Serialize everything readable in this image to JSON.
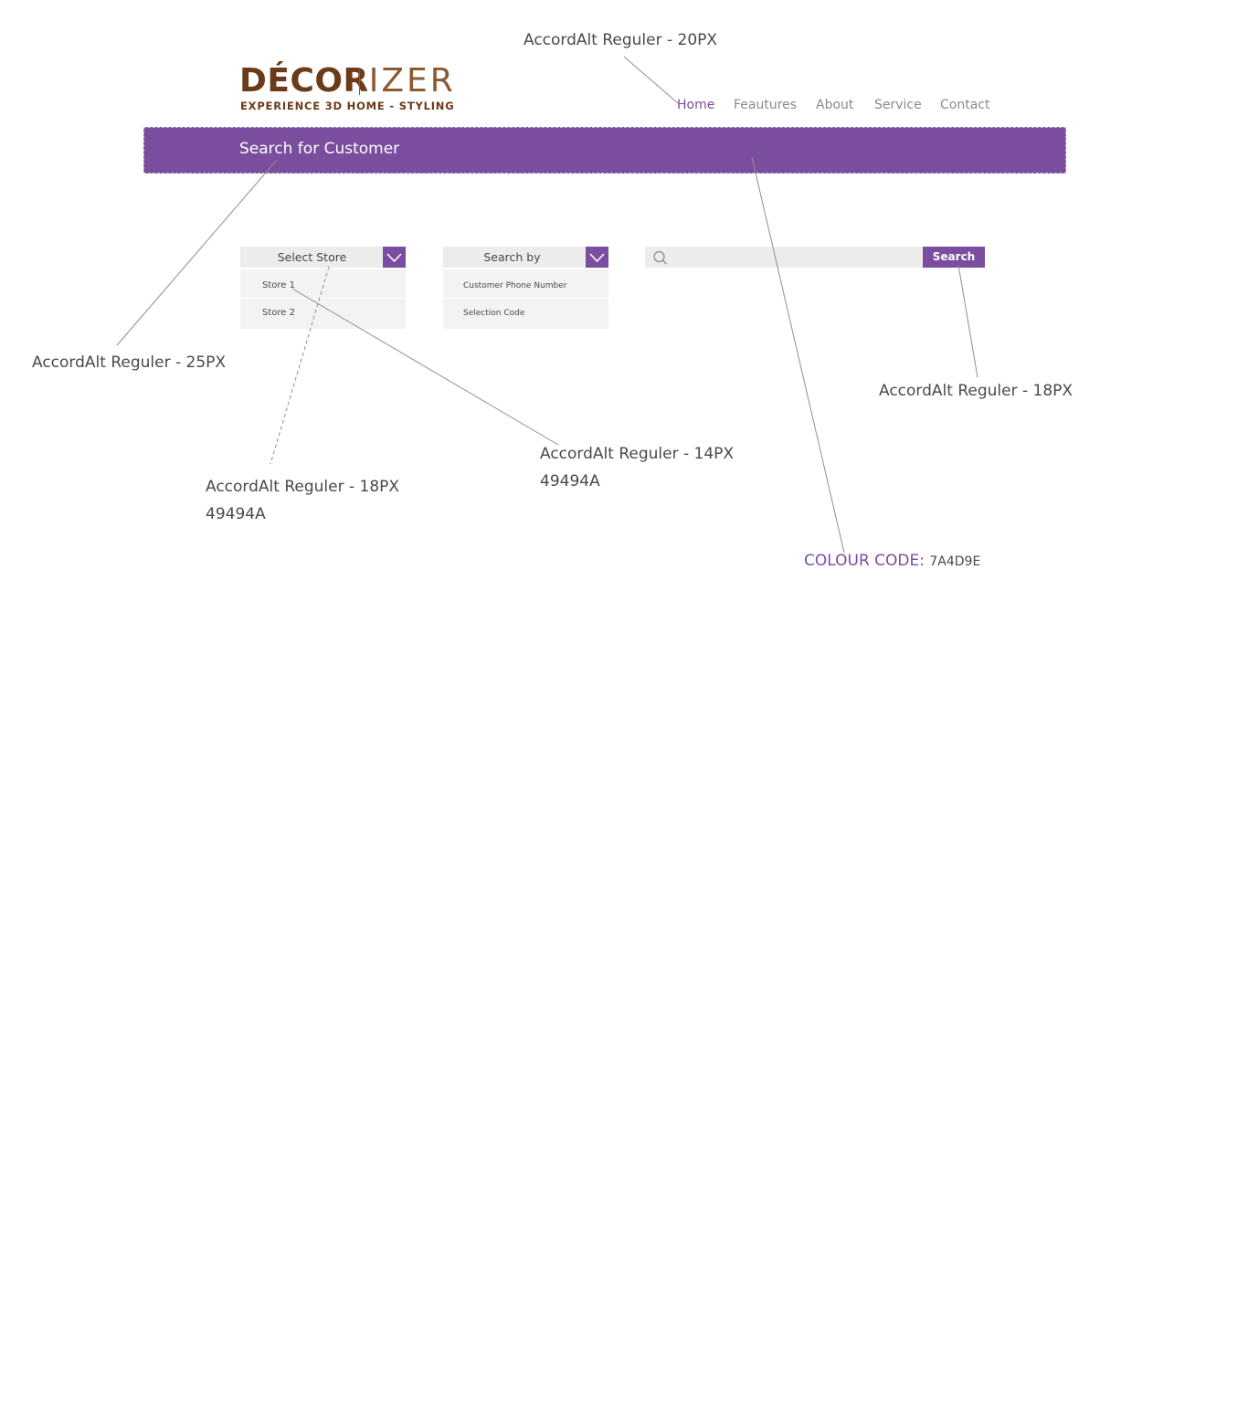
{
  "brand": {
    "logo_bold": "DÉCOR",
    "logo_light": "IZER",
    "tagline": "EXPERIENCE 3D HOME - STYLING"
  },
  "nav": {
    "items": [
      {
        "label": "Home",
        "active": true
      },
      {
        "label": "Feautures",
        "active": false
      },
      {
        "label": "About",
        "active": false
      },
      {
        "label": "Service",
        "active": false
      },
      {
        "label": "Contact",
        "active": false
      }
    ]
  },
  "banner": {
    "title": "Search for Customer"
  },
  "store_dropdown": {
    "label": "Select Store",
    "options": [
      "Store 1",
      "Store 2"
    ]
  },
  "searchby_dropdown": {
    "label": "Search by",
    "options": [
      "Customer Phone Number",
      "Selection Code"
    ]
  },
  "search": {
    "placeholder": "",
    "button_label": "Search"
  },
  "annotations": {
    "nav_font": "AccordAlt Reguler - 20PX",
    "banner_font": "AccordAlt Reguler - 25PX",
    "button_font": "AccordAlt Reguler - 18PX",
    "option_font": "AccordAlt Reguler - 14PX",
    "option_color": "49494A",
    "dropdown_font": "AccordAlt Reguler - 18PX",
    "dropdown_color": "49494A",
    "colour_label": "COLOUR CODE:",
    "colour_value": "7A4D9E"
  },
  "colors": {
    "accent": "#7a4d9e",
    "text": "#49494a",
    "brand": "#6b3a18"
  },
  "icons": {
    "search": "search-icon",
    "dropdown": "chevron-down-icon"
  }
}
